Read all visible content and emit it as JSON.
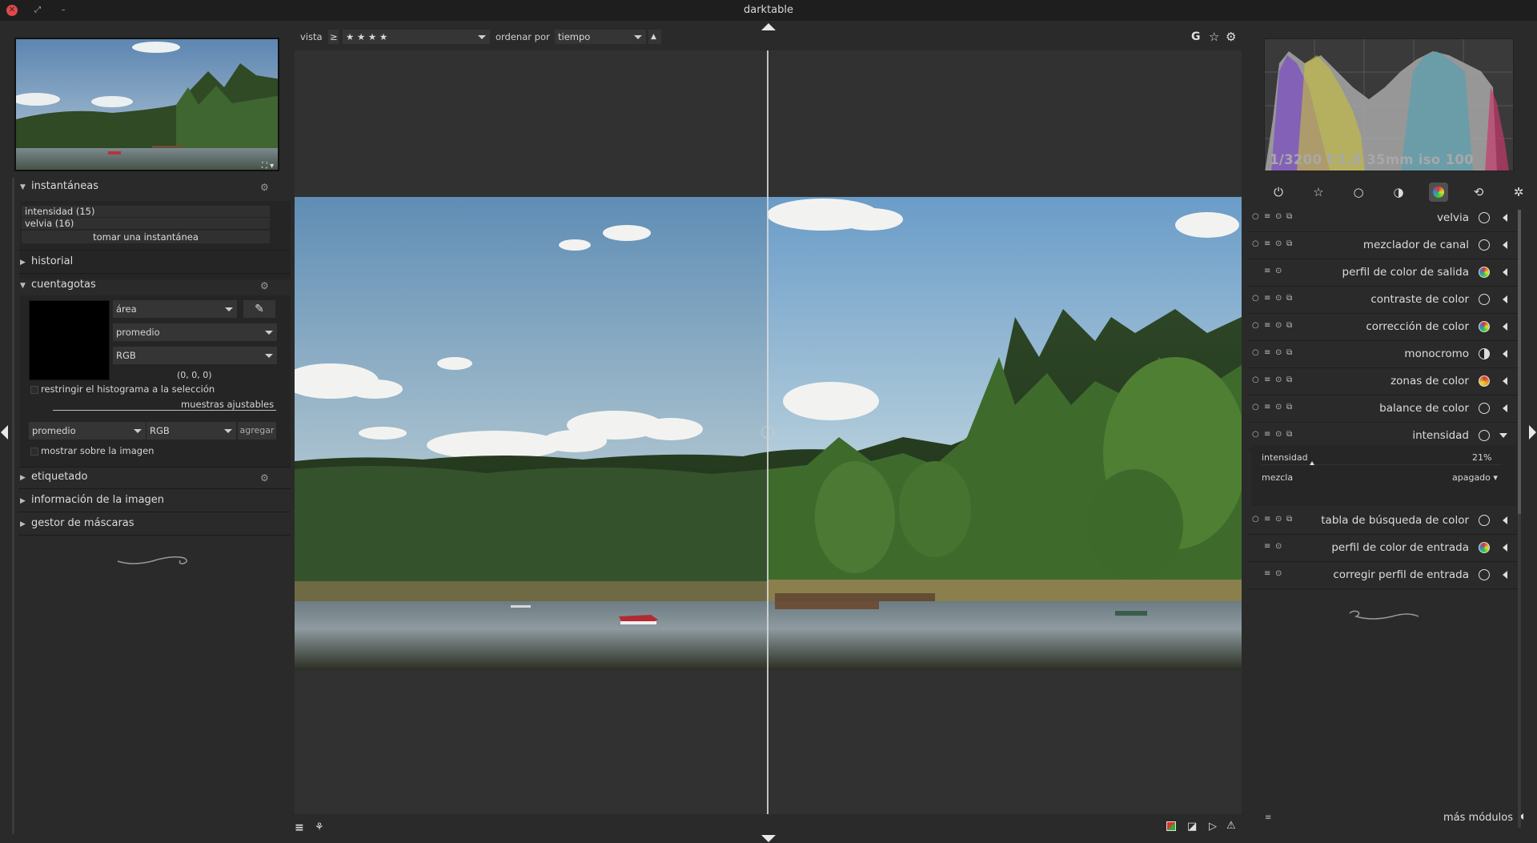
{
  "window": {
    "title": "darktable"
  },
  "filmstrip_toolbar": {
    "view_label": "vista",
    "rating_operator": "≥",
    "rating_value": "★ ★ ★ ★",
    "sort_label": "ordenar por",
    "sort_value": "tiempo",
    "sort_direction": "▲",
    "grouping": "G"
  },
  "left_panel": {
    "snapshots": {
      "title": "instantáneas",
      "items": [
        "intensidad (15)",
        "velvia (16)"
      ],
      "take_button": "tomar una instantánea"
    },
    "history": {
      "title": "historial"
    },
    "color_picker": {
      "title": "cuentagotas",
      "mode": "área",
      "statistic": "promedio",
      "color_model": "RGB",
      "value_readout": "(0, 0, 0)",
      "restrict_histogram_label": "restringir el histograma a la selección",
      "live_samples_label": "muestras ajustables",
      "sample_statistic": "promedio",
      "sample_model": "RGB",
      "add_button": "agregar",
      "display_on_image_label": "mostrar sobre la imagen"
    },
    "tagging": {
      "title": "etiquetado"
    },
    "image_information": {
      "title": "información de la imagen"
    },
    "mask_manager": {
      "title": "gestor de máscaras"
    }
  },
  "right_panel": {
    "histogram_info": "1/3200 f/1,8 35mm iso 100",
    "groups": [
      "power-icon",
      "star-icon",
      "circle-icon",
      "tone-icon",
      "color-icon",
      "correct-icon",
      "effect-icon"
    ],
    "modules": [
      {
        "name": "velvia",
        "icon": "velvia-icon"
      },
      {
        "name": "mezclador de canal",
        "icon": "channel-mixer-icon"
      },
      {
        "name": "perfil de color de salida",
        "icon": "output-profile-icon"
      },
      {
        "name": "contraste de color",
        "icon": "color-contrast-icon"
      },
      {
        "name": "corrección de color",
        "icon": "color-correction-icon"
      },
      {
        "name": "monocromo",
        "icon": "monochrome-icon"
      },
      {
        "name": "zonas de color",
        "icon": "color-zones-icon"
      },
      {
        "name": "balance de color",
        "icon": "color-balance-icon"
      },
      {
        "name": "intensidad",
        "icon": "vibrance-icon"
      },
      {
        "name": "tabla de búsqueda de color",
        "icon": "lut-icon"
      },
      {
        "name": "perfil de color de entrada",
        "icon": "input-profile-icon"
      },
      {
        "name": "corregir perfil de entrada",
        "icon": "unbreak-profile-icon"
      }
    ],
    "intensity_module": {
      "slider_label": "intensidad",
      "slider_value": "21%",
      "slider_fraction": 0.21,
      "blend_label": "mezcla",
      "blend_value": "apagado"
    },
    "more_modules": "más módulos"
  },
  "colors": {
    "accent_red": "#e0484b",
    "panel_bg": "#2a2a2a",
    "view_bg": "#313131"
  }
}
